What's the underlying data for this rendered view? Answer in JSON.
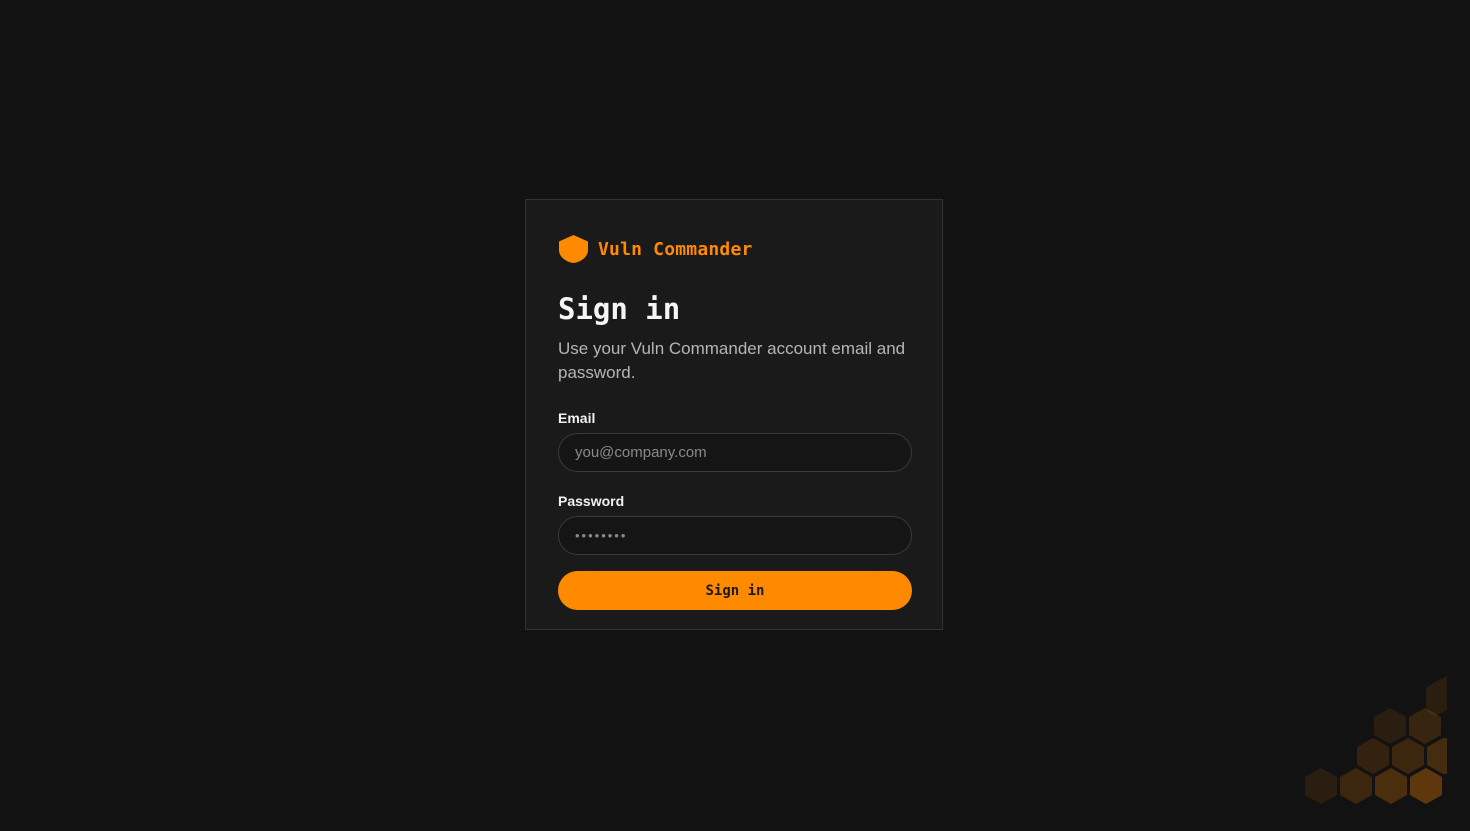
{
  "brand": {
    "name": "Vuln Commander",
    "icon": "shield-icon",
    "color": "#ff8a00"
  },
  "login": {
    "title": "Sign in",
    "subtitle": "Use your Vuln Commander account email and password.",
    "email_label": "Email",
    "email_placeholder": "you@company.com",
    "email_value": "",
    "password_label": "Password",
    "password_placeholder": "••••••••",
    "password_value": "",
    "submit_label": "Sign in"
  },
  "decoration": {
    "icon": "hexagon-pattern-icon",
    "color": "#ff8a00"
  }
}
